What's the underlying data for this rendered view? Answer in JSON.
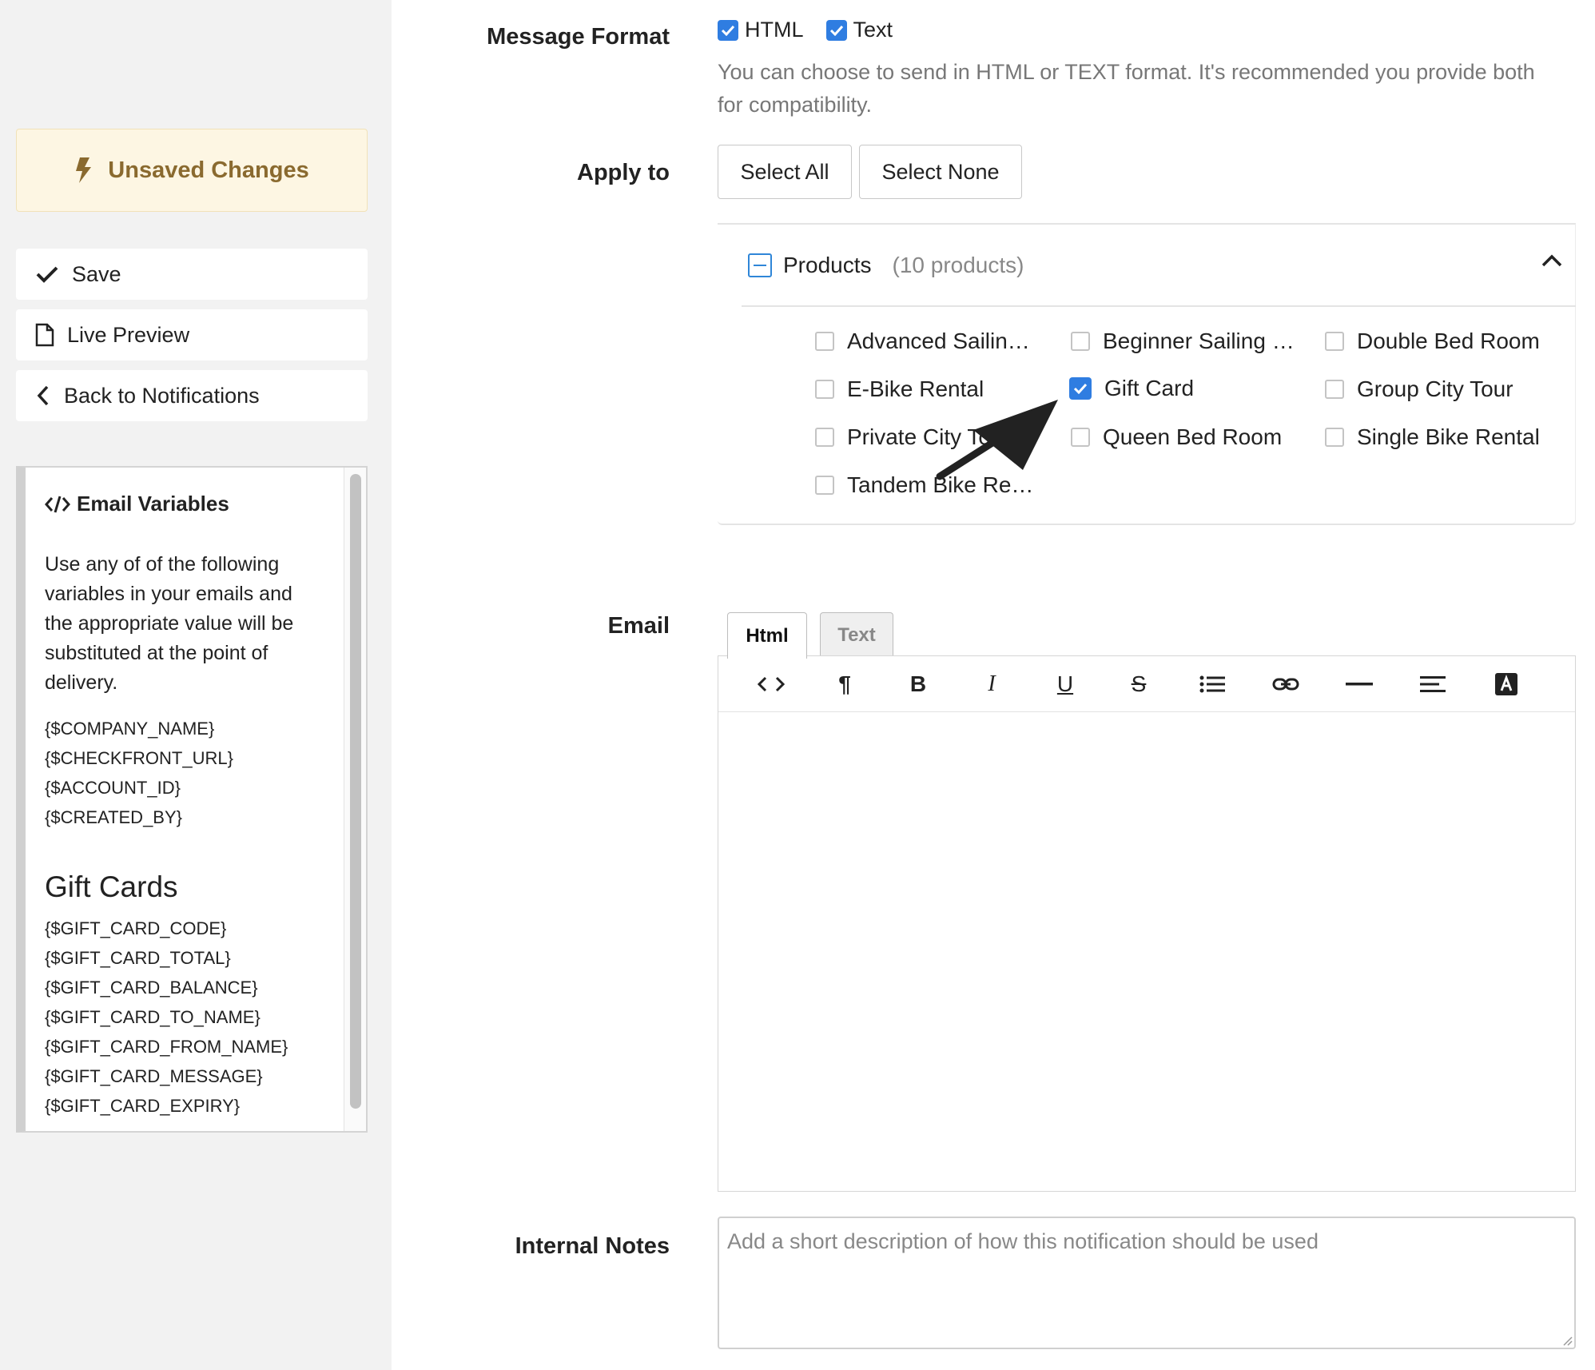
{
  "sidebar": {
    "unsaved_label": "Unsaved Changes",
    "save_label": "Save",
    "preview_label": "Live Preview",
    "back_label": "Back to Notifications",
    "variables": {
      "title": "Email Variables",
      "description": "Use any of of the following variables in your emails and the appropriate value will be substituted at the point of delivery.",
      "general": [
        "{$COMPANY_NAME}",
        "{$CHECKFRONT_URL}",
        "{$ACCOUNT_ID}",
        "{$CREATED_BY}"
      ],
      "gift_heading": "Gift Cards",
      "gift": [
        "{$GIFT_CARD_CODE}",
        "{$GIFT_CARD_TOTAL}",
        "{$GIFT_CARD_BALANCE}",
        "{$GIFT_CARD_TO_NAME}",
        "{$GIFT_CARD_FROM_NAME}",
        "{$GIFT_CARD_MESSAGE}",
        "{$GIFT_CARD_EXPIRY}"
      ]
    }
  },
  "form": {
    "message_format": {
      "label": "Message Format",
      "html_label": "HTML",
      "text_label": "Text",
      "html_checked": true,
      "text_checked": true,
      "help": "You can choose to send in HTML or TEXT format. It's recommended you provide both for compatibility."
    },
    "apply_to": {
      "label": "Apply to",
      "select_all": "Select All",
      "select_none": "Select None",
      "products_title": "Products",
      "products_count": "(10 products)",
      "products": [
        {
          "name": "Advanced Sailin…",
          "checked": false
        },
        {
          "name": "Beginner Sailing …",
          "checked": false
        },
        {
          "name": "Double Bed Room",
          "checked": false
        },
        {
          "name": "E-Bike Rental",
          "checked": false
        },
        {
          "name": "Gift Card",
          "checked": true
        },
        {
          "name": "Group City Tour",
          "checked": false
        },
        {
          "name": "Private City Tour",
          "checked": false
        },
        {
          "name": "Queen Bed Room",
          "checked": false
        },
        {
          "name": "Single Bike Rental",
          "checked": false
        },
        {
          "name": "Tandem Bike Re…",
          "checked": false
        }
      ]
    },
    "email": {
      "label": "Email",
      "tab_html": "Html",
      "tab_text": "Text",
      "active_tab": "Html",
      "toolbar": {
        "code": "<>",
        "paragraph": "¶",
        "bold": "B",
        "italic": "I",
        "underline": "U",
        "strike": "S"
      }
    },
    "internal_notes": {
      "label": "Internal Notes",
      "placeholder": "Add a short description of how this notification should be used"
    }
  },
  "colors": {
    "accent": "#2f7de1",
    "unsaved_bg": "#fdf6e3",
    "unsaved_text": "#8a6a2f"
  }
}
